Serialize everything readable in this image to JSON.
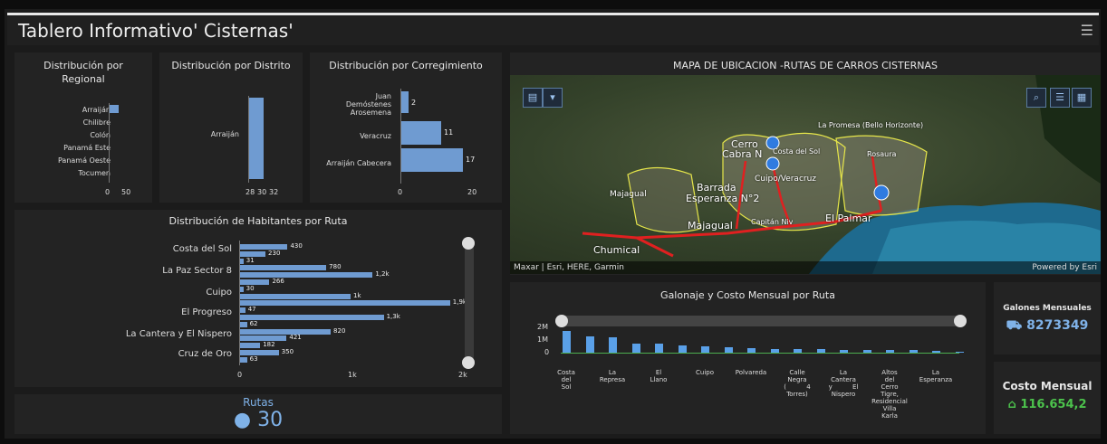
{
  "header": {
    "title": "Tablero Informativo' Cisternas'",
    "menu_icon": "hamburger-icon"
  },
  "regional": {
    "title_line1": "Distribución por",
    "title_line2": "Regional",
    "categories": [
      "Arraiján",
      "Chilibre",
      "Colón",
      "Panamá Este",
      "Panamá Oeste",
      "Tocumen"
    ],
    "ticks": [
      "0",
      "50"
    ]
  },
  "distrito": {
    "title": "Distribución por Distrito",
    "category": "Arraiján",
    "ticks": [
      "28",
      "30",
      "32"
    ]
  },
  "corregimiento": {
    "title": "Distribución por Corregimiento",
    "categories": [
      "Juan Demóstenes Arosemena",
      "Veracruz",
      "Arraiján Cabecera"
    ],
    "cat1_line1": "Juan",
    "cat1_line2": "Demóstenes",
    "cat1_line3": "Arosemena",
    "values": [
      2,
      11,
      17
    ],
    "value_labels": [
      "2",
      "11",
      "17"
    ],
    "ticks": [
      "0",
      "20"
    ]
  },
  "habitantes": {
    "title": "Distribución de Habitantes por Ruta",
    "labels": [
      "Costa del Sol",
      "La Paz Sector 8",
      "Cuipo",
      "El Progreso",
      "La Cantera y El Nispero",
      "Cruz de Oro"
    ],
    "bars": [
      430,
      230,
      31,
      780,
      1200,
      266,
      30,
      1000,
      1900,
      47,
      1300,
      62,
      820,
      421,
      182,
      350,
      63
    ],
    "bar_labels": [
      "430",
      "230",
      "31",
      "780",
      "1,2k",
      "266",
      "30",
      "1k",
      "1,9k",
      "47",
      "1,3k",
      "62",
      "820",
      "421",
      "182",
      "350",
      "63"
    ],
    "ticks": [
      "0",
      "1k",
      "2k"
    ]
  },
  "rutas": {
    "label": "Rutas",
    "value": "30",
    "icon": "map-pin-icon"
  },
  "map": {
    "title": "MAPA DE UBICACION -RUTAS DE CARROS CISTERNAS",
    "attribution": "Maxar | Esri, HERE, Garmin",
    "powered": "Powered by Esri",
    "labels": {
      "cerro": "Cerro",
      "cabra": "Cabra N",
      "costa": "Costa del Sol",
      "cuipo": "Cuipo/Veracruz",
      "barrada": "Barrada",
      "esperanza": "Esperanza N°2",
      "majagual": "Majagual",
      "majagual2": "Majagual",
      "capitan": "Capitán Niv",
      "palmar": "El Palmar",
      "promesa": "La Promesa (Bello Horizonte)",
      "rosaura": "Rosaura",
      "chumical": "Chumical"
    }
  },
  "galonaje": {
    "title": "Galonaje  y Costo Mensual por Ruta",
    "yticks": [
      "2M",
      "1M",
      "0"
    ],
    "values": [
      1.75,
      1.3,
      1.2,
      0.75,
      0.7,
      0.6,
      0.5,
      0.4,
      0.35,
      0.32,
      0.3,
      0.28,
      0.25,
      0.22,
      0.2,
      0.18,
      0.15,
      0.1
    ],
    "xlabels": [
      "Costa del Sol",
      "La Represa",
      "El Llano",
      "Cuipo",
      "Polvareda",
      "Calle Negra ( 4 Torres)",
      "La Cantera y El Nispero",
      "Altos del Cerro Tigre, Residencial Villa Karla",
      "La Esperanza"
    ]
  },
  "galones": {
    "label": "Galones Mensuales",
    "value": "8273349",
    "icon": "truck-icon"
  },
  "costo": {
    "label": "Costo Mensual",
    "value": "116.654,2",
    "icon": "money-icon"
  },
  "colors": {
    "bar": "#6f9bd1",
    "galones": "#7fb2e8",
    "costo": "#4cc24c"
  }
}
